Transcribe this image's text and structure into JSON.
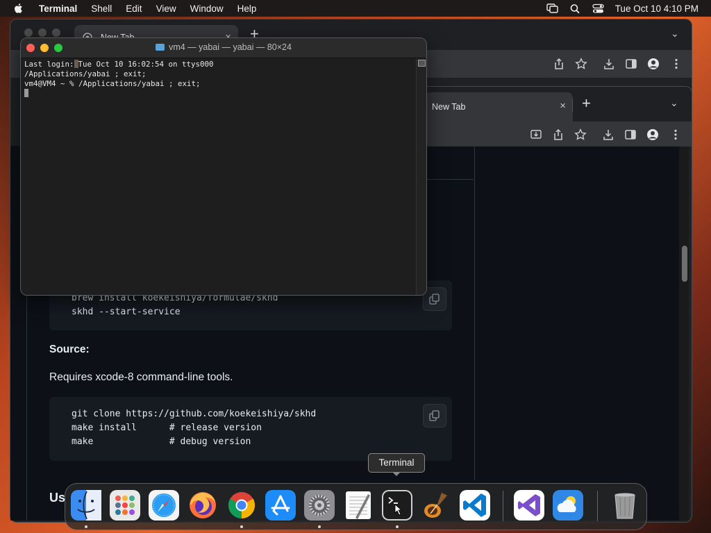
{
  "menubar": {
    "app_name": "Terminal",
    "items": [
      "Shell",
      "Edit",
      "View",
      "Window",
      "Help"
    ],
    "clock": "Tue Oct 10  4:10 PM"
  },
  "chrome_back": {
    "tab_title": "New Tab",
    "tab_close": "×",
    "new_tab": "+",
    "chevron": "⌄"
  },
  "chrome_front": {
    "tab_title": "New Tab",
    "tab_close": "×",
    "new_tab": "+",
    "chevron": "⌄"
  },
  "document": {
    "code_block_1": "brew install koekeishiya/formulae/skhd\nskhd --start-service",
    "source_heading": "Source:",
    "source_text": "Requires xcode-8 command-line tools.",
    "code_block_2": "git clone https://github.com/koekeishiya/skhd\nmake install      # release version\nmake              # debug version",
    "cut_heading": "Us"
  },
  "terminal": {
    "title": "vm4 — yabai — yabai — 80×24",
    "line1_prefix": "Last login:",
    "line1_rest": "Tue Oct 10 16:02:54 on ttys000",
    "line2": "/Applications/yabai ; exit;",
    "line3": "vm4@VM4 ~ % /Applications/yabai ; exit;"
  },
  "tooltip": {
    "label": "Terminal"
  },
  "dock": {
    "apps": [
      {
        "name": "Finder",
        "icon": "finder-icon",
        "running": true
      },
      {
        "name": "Launchpad",
        "icon": "launchpad-icon",
        "running": false
      },
      {
        "name": "Safari",
        "icon": "safari-icon",
        "running": false
      },
      {
        "name": "Firefox",
        "icon": "firefox-icon",
        "running": false
      },
      {
        "name": "Google Chrome",
        "icon": "chrome-icon",
        "running": true
      },
      {
        "name": "App Store",
        "icon": "app-store-icon",
        "running": false
      },
      {
        "name": "System Settings",
        "icon": "system-settings-icon",
        "running": true
      },
      {
        "name": "TextEdit",
        "icon": "textedit-icon",
        "running": false
      },
      {
        "name": "Terminal",
        "icon": "terminal-icon",
        "running": true
      },
      {
        "name": "Instruments",
        "icon": "instruments-icon",
        "running": false
      },
      {
        "name": "Visual Studio Code",
        "icon": "vscode-icon",
        "running": false
      },
      {
        "name": "Visual Studio",
        "icon": "visual-studio-icon",
        "running": false
      },
      {
        "name": "Weather",
        "icon": "weather-icon",
        "running": false
      },
      {
        "name": "Trash",
        "icon": "trash-icon",
        "running": false
      }
    ]
  }
}
